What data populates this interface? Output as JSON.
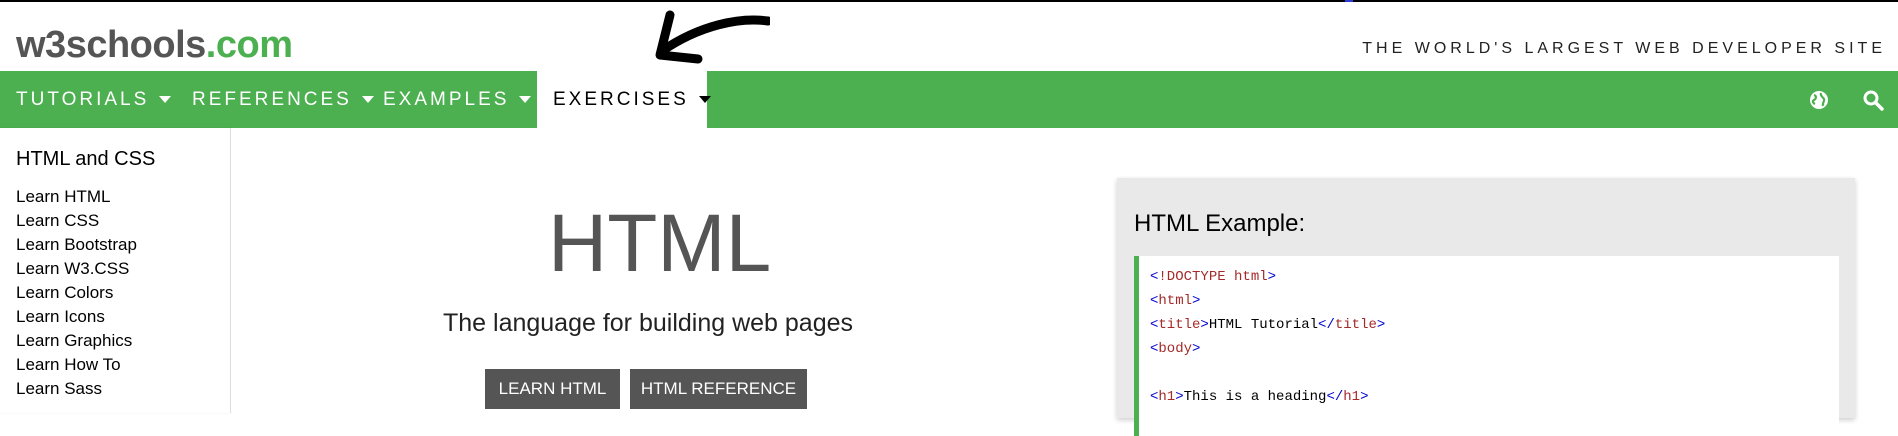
{
  "header": {
    "logo_main": "w3schools",
    "logo_suffix": ".com",
    "tagline": "THE WORLD'S LARGEST WEB DEVELOPER SITE"
  },
  "nav": {
    "items": [
      {
        "label": "TUTORIALS"
      },
      {
        "label": "REFERENCES"
      },
      {
        "label": "EXAMPLES"
      },
      {
        "label": "EXERCISES"
      }
    ],
    "icons": [
      "globe-icon",
      "search-icon"
    ]
  },
  "sidebar": {
    "heading": "HTML and CSS",
    "items": [
      {
        "label": "Learn HTML"
      },
      {
        "label": "Learn CSS"
      },
      {
        "label": "Learn Bootstrap"
      },
      {
        "label": "Learn W3.CSS"
      },
      {
        "label": "Learn Colors"
      },
      {
        "label": "Learn Icons"
      },
      {
        "label": "Learn Graphics"
      },
      {
        "label": "Learn How To"
      },
      {
        "label": "Learn Sass"
      }
    ]
  },
  "hero": {
    "title": "HTML",
    "subtitle": "The language for building web pages",
    "buttons": [
      {
        "label": "LEARN HTML"
      },
      {
        "label": "HTML REFERENCE"
      }
    ]
  },
  "example": {
    "title": "HTML Example:",
    "code": {
      "doctype_open": "<",
      "doctype_tag": "!DOCTYPE",
      "doctype_attr": "html",
      "doctype_close": ">",
      "html_tag": "html",
      "title_tag": "title",
      "title_text": "HTML Tutorial",
      "body_tag": "body",
      "h1_tag": "h1",
      "h1_text": "This is a heading"
    }
  },
  "colors": {
    "brand_green": "#4CAF50",
    "button_gray": "#555555"
  }
}
